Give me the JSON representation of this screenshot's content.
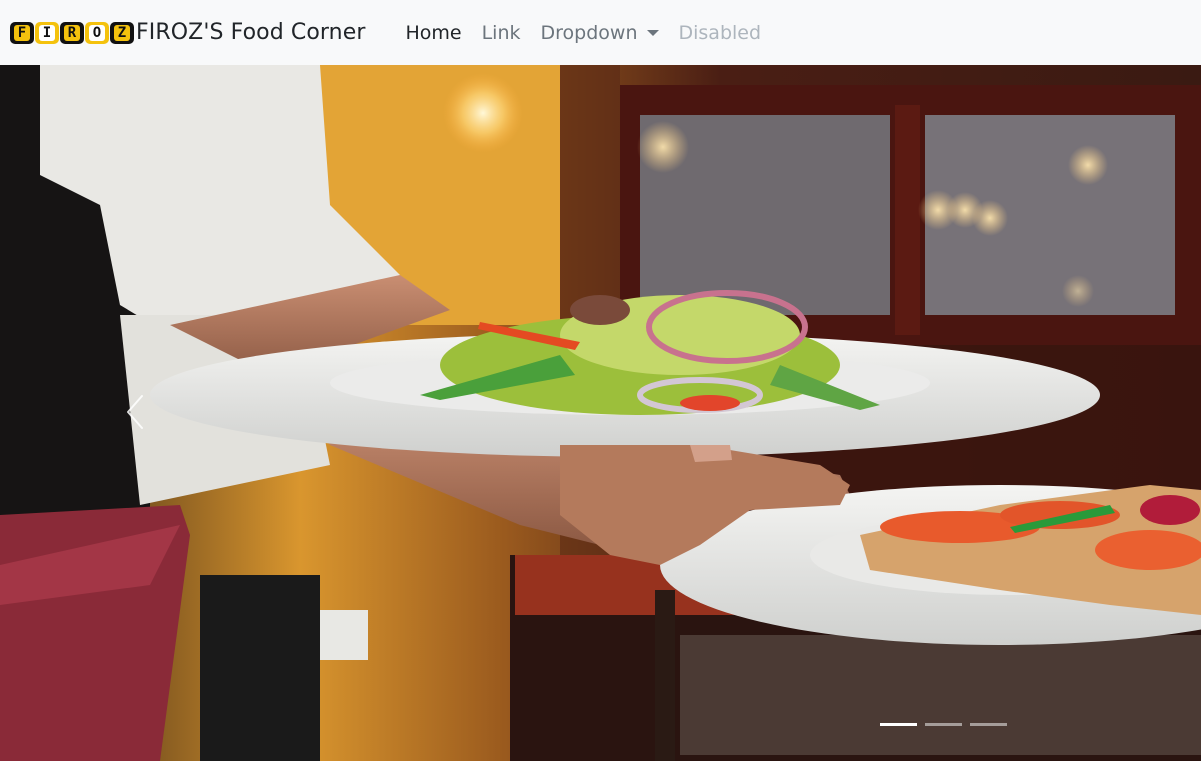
{
  "navbar": {
    "logo_letters": [
      "F",
      "I",
      "R",
      "O",
      "Z"
    ],
    "brand_title": "FIROZ'S Food Corner",
    "links": {
      "home": "Home",
      "link": "Link",
      "dropdown": "Dropdown",
      "disabled": "Disabled"
    }
  },
  "carousel": {
    "image": "restaurant-waiter-serving-salad-and-bruschetta-plates",
    "slide_count": 3,
    "active_slide": 1,
    "prev_icon": "chevron-left-icon"
  },
  "colors": {
    "navbar_bg": "#f8f9fa",
    "logo_dark": "#111111",
    "logo_yellow": "#f4c20d",
    "link_active": "#212529",
    "link_muted": "#6c757d",
    "link_disabled": "#adb5bd"
  }
}
